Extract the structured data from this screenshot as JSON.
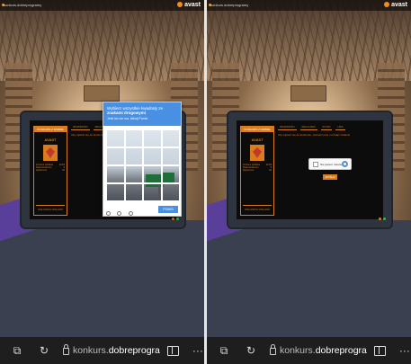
{
  "panels": [
    {
      "id": "left",
      "header": {
        "site": "konkurs.dobreprogramy",
        "brand": "avast"
      },
      "game": {
        "sidebar_title": "KONKURS Z DOBRE",
        "logo_text": "AVAST",
        "rows": [
          [
            "Konkurs publikka",
            "21/83"
          ],
          [
            "Statut konkursu",
            "3"
          ],
          [
            "Zgłoszenie",
            "84"
          ]
        ],
        "zgl_button": "ZGŁASZAJ ZGŁASZ",
        "tabs": [
          "WIADOMOŚCI",
          "REGULAMIN",
          "WYNIKI",
          "LINKI"
        ],
        "intro": "Aby zgłosić się do konkursu, zaznacz pole i rozwiąż zadanie"
      },
      "captcha": {
        "title_prefix": "Wybierz wszystkie kwadraty ze",
        "title_bold": "znakami drogowymi",
        "subtitle": "Jeśli ich nie ma, kliknij Pomiń",
        "verify": "POMIŃ"
      }
    },
    {
      "id": "right",
      "header": {
        "site": "konkurs.dobreprogramy",
        "brand": "avast"
      },
      "game": {
        "sidebar_title": "KONKURS Z DOBRE",
        "logo_text": "AVAST",
        "rows": [
          [
            "Konkurs publikka",
            "21/83"
          ],
          [
            "Statut konkursu",
            "3"
          ],
          [
            "Zgłoszenie",
            "84"
          ]
        ],
        "zgl_button": "ZGŁASZAJ ZGŁASZ",
        "tabs": [
          "WIADOMOŚCI",
          "REGULAMIN",
          "WYNIKI",
          "LINKI"
        ],
        "intro": "Aby zgłosić się do konkursu, zaznacz pole i rozwiąż zadanie",
        "recaptcha_label": "Nie jestem robotem",
        "send": "WYŚLIJ"
      }
    }
  ],
  "toolbar": {
    "url_prefix": "konkurs.",
    "url_domain": "dobreprogra",
    "more": "···"
  },
  "colors": {
    "accent": "#d97c1e",
    "captcha_blue": "#4a90e2",
    "toolbar_bg": "#1e1e1e"
  }
}
